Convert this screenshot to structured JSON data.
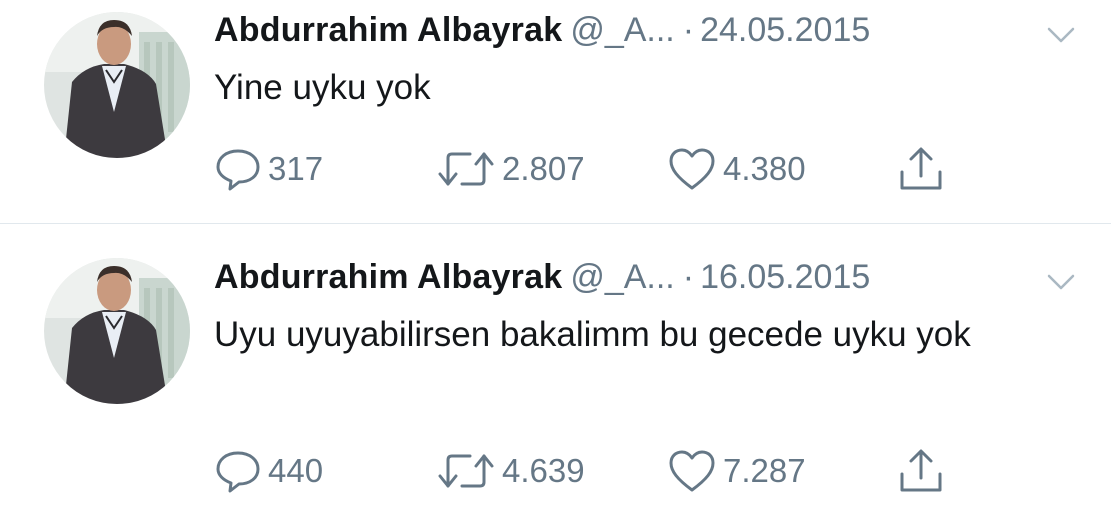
{
  "tweets": [
    {
      "author_name": "Abdurrahim Albayrak",
      "handle": "@_A...",
      "separator": "·",
      "date": "24.05.2015",
      "text": "Yine uyku yok",
      "replies": "317",
      "retweets": "2.807",
      "likes": "4.380",
      "icons": [
        "reply-icon",
        "retweet-icon",
        "like-icon",
        "share-icon",
        "chevron-down-icon"
      ]
    },
    {
      "author_name": "Abdurrahim Albayrak",
      "handle": "@_A...",
      "separator": "·",
      "date": "16.05.2015",
      "text": "Uyu uyuyabilirsen bakalimm bu gecede uyku yok",
      "replies": "440",
      "retweets": "4.639",
      "likes": "7.287",
      "icons": [
        "reply-icon",
        "retweet-icon",
        "like-icon",
        "share-icon",
        "chevron-down-icon"
      ]
    }
  ],
  "colors": {
    "text_primary": "#14171a",
    "text_secondary": "#657786",
    "divider": "#e1e8ed"
  }
}
